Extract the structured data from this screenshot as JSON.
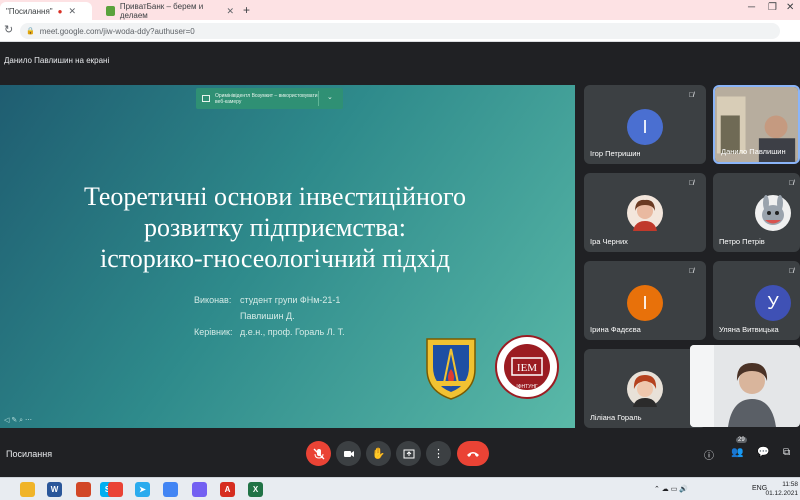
{
  "browser": {
    "tabs": [
      {
        "label": "\"Посилання\"",
        "recording_icon": "record-dot-icon",
        "active": true
      },
      {
        "label": "ПриватБанк – берем и делаем",
        "active": false
      }
    ],
    "new_tab": "+",
    "url": "meet.google.com/jiw-woda-ddy?authuser=0"
  },
  "meet": {
    "presenting_label": "Данило Павлишин на екрані",
    "meeting_title": "Посилання",
    "participant_count": "29",
    "banner_text": "Оримінівідентл Возумкит – використовувати веб-камеру"
  },
  "slide": {
    "title_lines": [
      "Теоретичні основи інвестиційного",
      "розвитку підприємства:",
      "історико-гносеологічний підхід"
    ],
    "meta": [
      {
        "label": "Виконав:",
        "value": "студент групи ФНм-21-1"
      },
      {
        "label": "",
        "value": "Павлишин Д."
      },
      {
        "label": "Керівник:",
        "value": "д.е.н., проф. Гораль Л. Т."
      }
    ],
    "logo_right_text": "ІЕМ",
    "logo_right_sub": "ІФНТУНГ"
  },
  "participants": [
    {
      "name": "Ігор Петришин",
      "initial": "І",
      "color": "#4a6fd1",
      "muted": true
    },
    {
      "name": "Данило Павлишин",
      "video": true,
      "pinned": true
    },
    {
      "name": "Іра Черних",
      "photo": true,
      "muted": true
    },
    {
      "name": "Петро Петрів",
      "photo": true,
      "muted": true
    },
    {
      "name": "Ірина Фадєєва",
      "initial": "І",
      "color": "#e8710a",
      "muted": true
    },
    {
      "name": "Уляна Витвицька",
      "initial": "У",
      "color": "#3f51b5",
      "muted": true
    },
    {
      "name": "Ліліана Гораль",
      "photo": true
    }
  ],
  "taskbar": {
    "language": "ENG",
    "time": "11:58",
    "date": "01.12.2021"
  }
}
